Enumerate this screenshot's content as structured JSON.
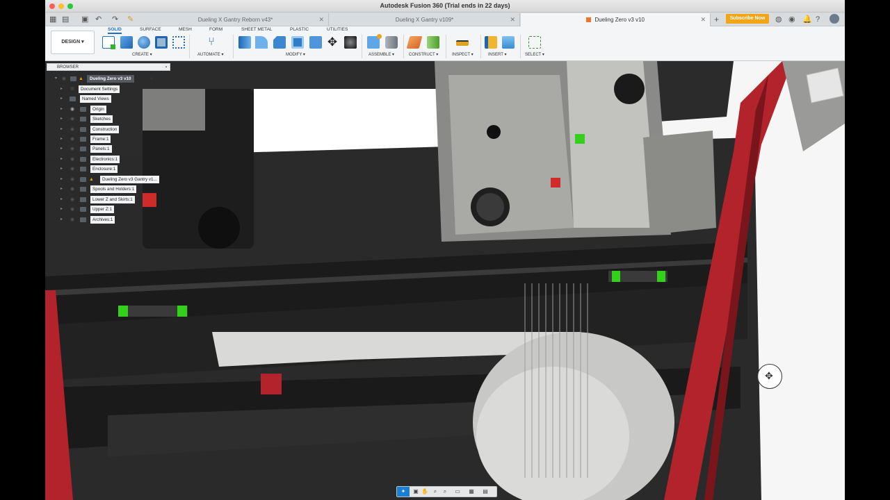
{
  "window": {
    "title": "Autodesk Fusion 360 (Trial ends in 22 days)"
  },
  "tabs": [
    {
      "label": "Dueling X Gantry Reborn v43*",
      "active": false
    },
    {
      "label": "Dueling X Gantry v109*",
      "active": false
    },
    {
      "label": "Dueling Zero v3 v10",
      "active": true
    }
  ],
  "subscribe_label": "Subscribe Now",
  "toolbar": {
    "workspace_label": "DESIGN",
    "workspace_tabs": [
      "SOLID",
      "SURFACE",
      "MESH",
      "FORM",
      "SHEET METAL",
      "PLASTIC",
      "UTILITIES"
    ],
    "groups": [
      "CREATE",
      "AUTOMATE",
      "MODIFY",
      "ASSEMBLE",
      "CONSTRUCT",
      "INSPECT",
      "INSERT",
      "SELECT"
    ]
  },
  "browser": {
    "header": "BROWSER",
    "root": "Dueling Zero v3 v10",
    "items": [
      "Document Settings",
      "Named Views",
      "Origin",
      "Sketches",
      "Construction",
      "Frame:1",
      "Panels:1",
      "Electronics:1",
      "Enclosure:1",
      "Dueling Zero v3 Gantry v1...",
      "Spools and Holders:1",
      "Lower Z and Skirts:1",
      "Upper Z:1",
      "Archives:1"
    ]
  },
  "colors": {
    "accent": "#1a6fc4",
    "subscribe": "#f2a516",
    "frame_red": "#b3232b",
    "linear_rail_green": "#34d11c"
  }
}
